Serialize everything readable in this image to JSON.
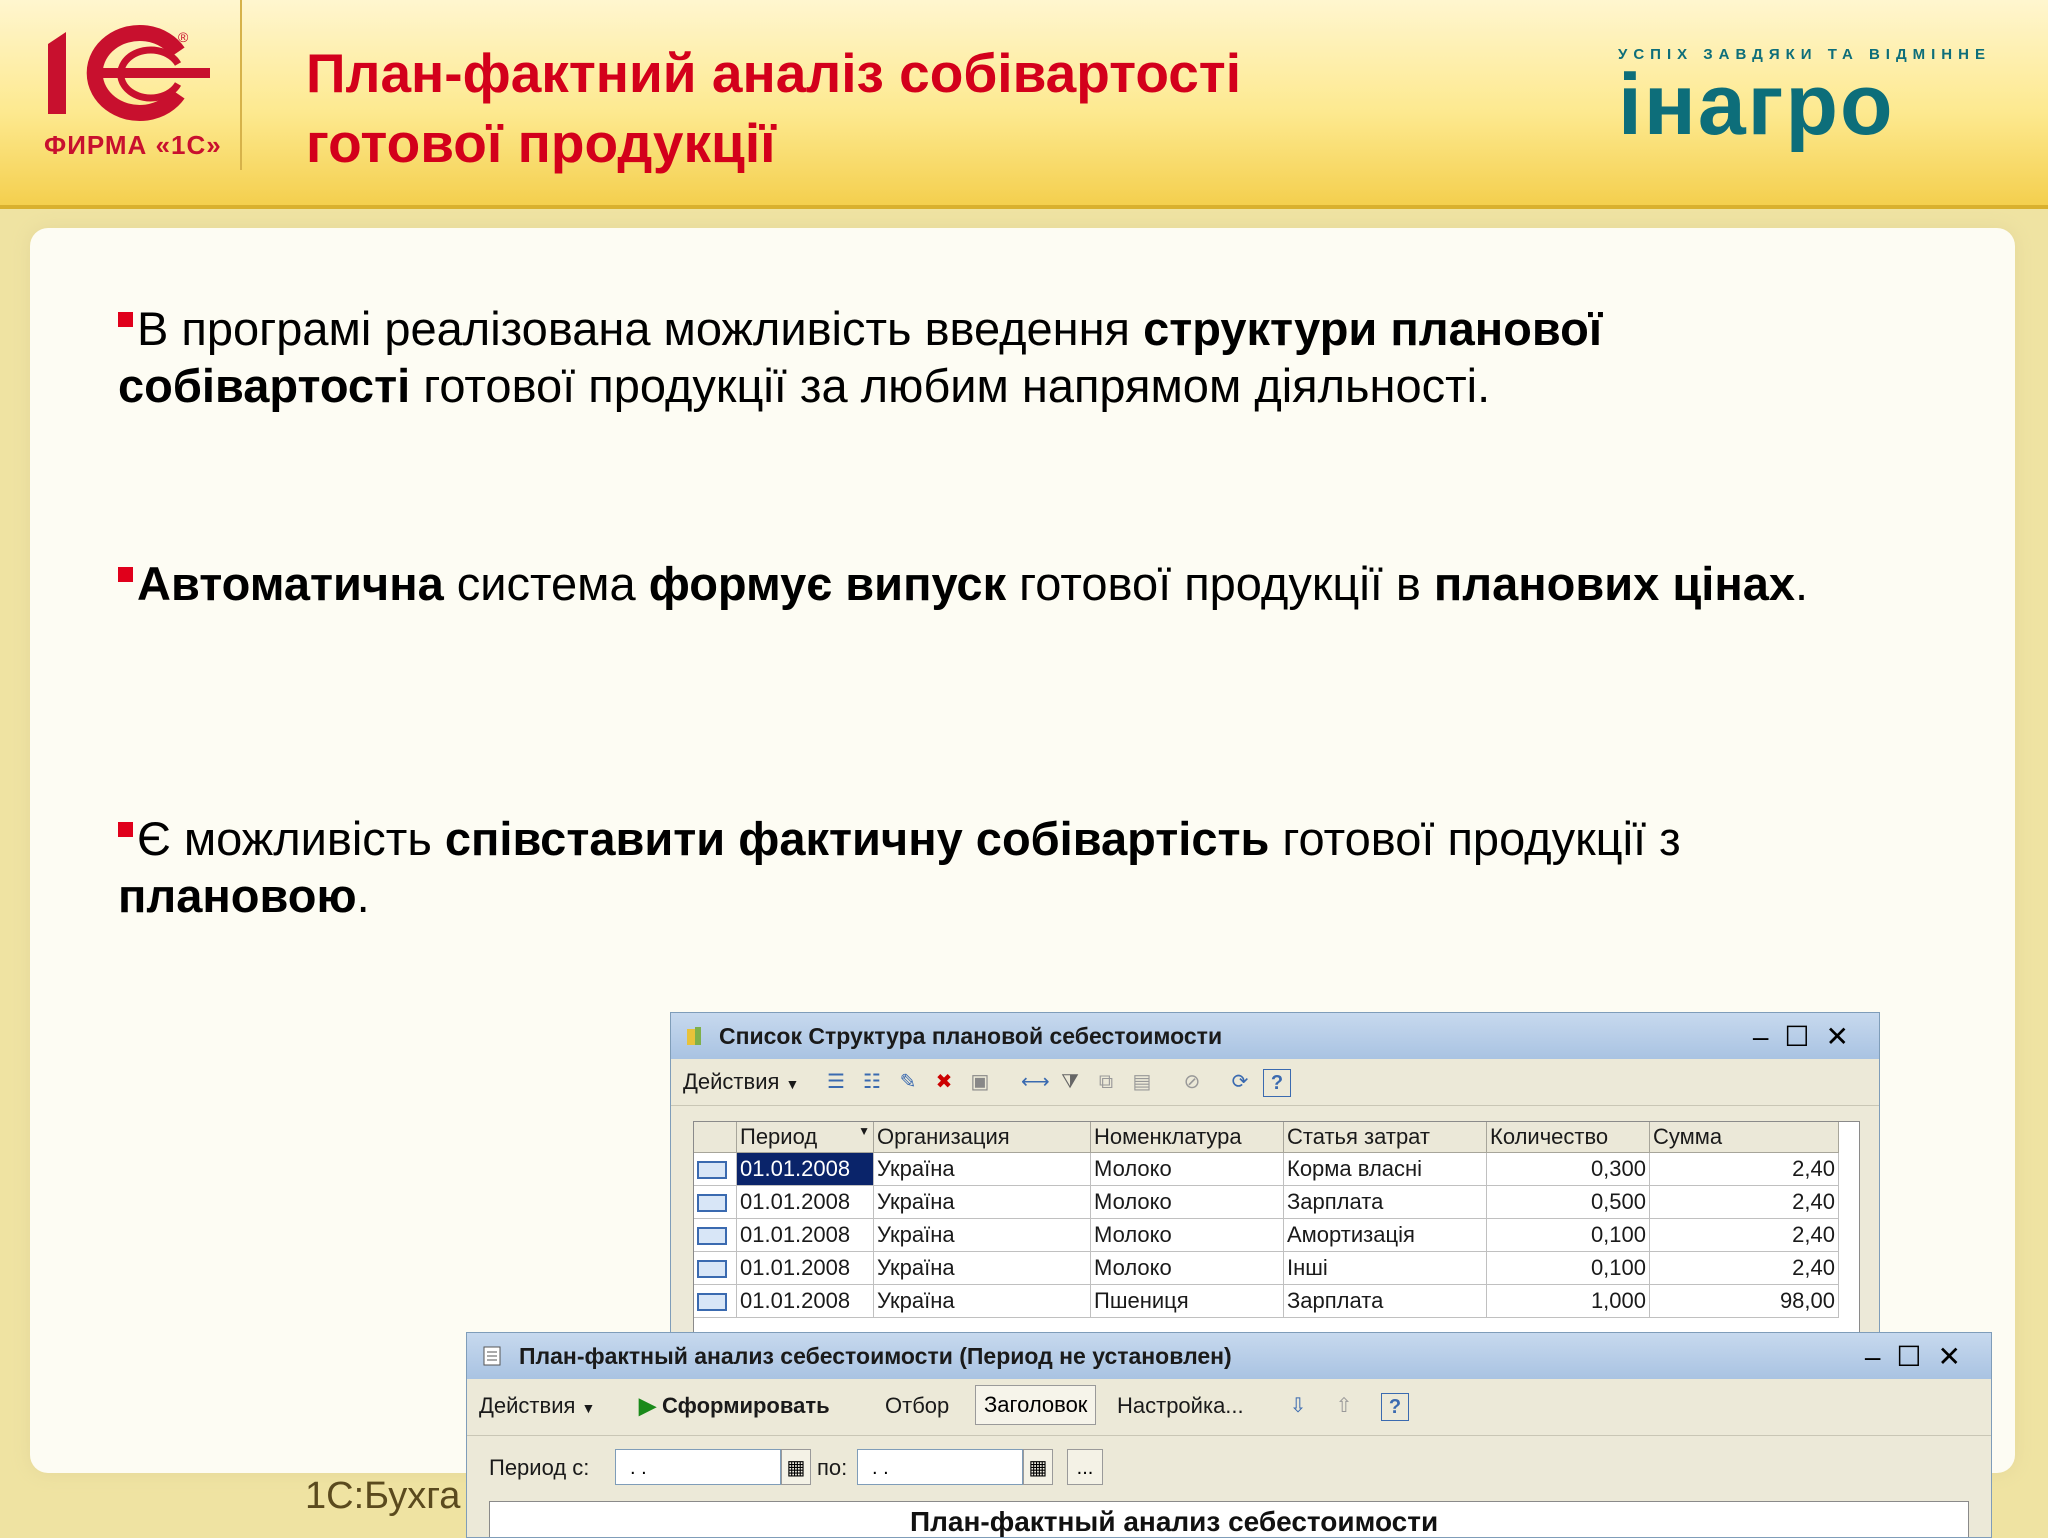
{
  "header": {
    "title_line1": "План-фактний аналіз собівартості",
    "title_line2": "готової продукції",
    "logo_1c": {
      "text": "1С",
      "sub": "ФИРМА «1С»"
    },
    "logo_inagro": {
      "tagline": "УСПІХ ЗАВДЯКИ ТА ВІДМІННЕ",
      "text": "інагро"
    },
    "accent_color": "#d3001b"
  },
  "bullets": [
    {
      "parts": [
        [
          "В програмі реалізована можливість введення ",
          false
        ],
        [
          "структури планової собівартості",
          true
        ],
        [
          " готової продукції за любим напрямом діяльності.",
          false
        ]
      ]
    },
    {
      "parts": [
        [
          "Автоматична",
          true
        ],
        [
          "  система ",
          false
        ],
        [
          "формує  випуск",
          true
        ],
        [
          " готової продукції в ",
          false
        ],
        [
          "планових цінах",
          true
        ],
        [
          ".",
          false
        ]
      ]
    },
    {
      "parts": [
        [
          "Є можливість ",
          false
        ],
        [
          "співставити фактичну собівартість",
          true
        ],
        [
          " готової продукції з ",
          false
        ],
        [
          "плановою",
          true
        ],
        [
          ".",
          false
        ]
      ]
    }
  ],
  "footer": {
    "text": "1С:Бухга"
  },
  "window1": {
    "title": "Список Структура плановой себестоимости",
    "actions_label": "Действия",
    "columns": [
      "Период",
      "Организация",
      "Номенклатура",
      "Статья затрат",
      "Количество",
      "Сумма"
    ],
    "rows": [
      [
        "01.01.2008",
        "Україна",
        "Молоко",
        "Корма власні",
        "0,300",
        "2,40"
      ],
      [
        "01.01.2008",
        "Україна",
        "Молоко",
        "Зарплата",
        "0,500",
        "2,40"
      ],
      [
        "01.01.2008",
        "Україна",
        "Молоко",
        "Амортизація",
        "0,100",
        "2,40"
      ],
      [
        "01.01.2008",
        "Україна",
        "Молоко",
        "Інші",
        "0,100",
        "2,40"
      ],
      [
        "01.01.2008",
        "Україна",
        "Пшениця",
        "Зарплата",
        "1,000",
        "98,00"
      ]
    ]
  },
  "window2": {
    "title": "План-фактный анализ себестоимости (Период не установлен)",
    "actions_label": "Действия",
    "generate_label": "Сформировать",
    "filter_label": "Отбор",
    "header_label": "Заголовок",
    "settings_label": "Настройка...",
    "period_from_label": "Период с:",
    "period_to_label": "по:",
    "period_from_value": " .  .",
    "period_to_value": " .  .",
    "ellipsis_label": "...",
    "report_title": "План-фактный анализ себестоимости"
  }
}
